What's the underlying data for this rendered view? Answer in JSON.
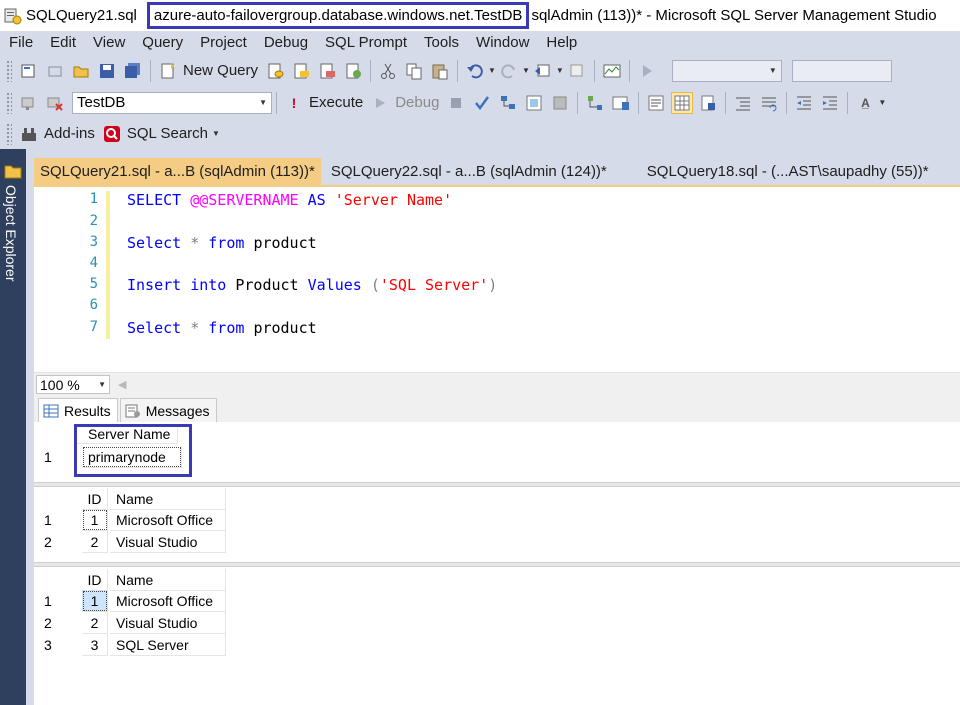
{
  "window": {
    "file_title": "SQLQuery21.sql",
    "server_db": "azure-auto-failovergroup.database.windows.net.TestDB",
    "title_rest": "sqlAdmin (113))* - Microsoft SQL Server Management Studio"
  },
  "menu": [
    "File",
    "Edit",
    "View",
    "Query",
    "Project",
    "Debug",
    "SQL Prompt",
    "Tools",
    "Window",
    "Help"
  ],
  "toolbar": {
    "new_query": "New Query",
    "database": "TestDB",
    "execute": "Execute",
    "debug": "Debug",
    "add_ins": "Add-ins",
    "sql_search": "SQL Search"
  },
  "side_panel": {
    "label": "Object Explorer"
  },
  "tabs": [
    {
      "label": "SQLQuery21.sql - a...B (sqlAdmin (113))*",
      "active": true
    },
    {
      "label": "SQLQuery22.sql - a...B (sqlAdmin (124))*",
      "active": false
    },
    {
      "label": "SQLQuery18.sql - (...AST\\saupadhy (55))*",
      "active": false
    }
  ],
  "editor": {
    "line_numbers": [
      "1",
      "2",
      "3",
      "4",
      "5",
      "6",
      "7"
    ],
    "lines": [
      {
        "kw1": "SELECT",
        "sysvar": "@@SERVERNAME",
        "kw2": "AS",
        "str": "'Server Name'"
      },
      {
        "kw1": "Select",
        "op": "*",
        "kw2": "from",
        "id": "product"
      },
      {
        "kw1": "Insert",
        "kw2": "into",
        "id": "Product",
        "kw3": "Values",
        "lp": "(",
        "str": "'SQL Server'",
        "rp": ")"
      },
      {
        "kw1": "Select",
        "op": "*",
        "kw2": "from",
        "id": "product"
      }
    ]
  },
  "zoom": {
    "value": "100 %"
  },
  "result_tabs": {
    "results": "Results",
    "messages": "Messages"
  },
  "grid1": {
    "header": "Server Name",
    "row_num": "1",
    "value": "primarynode"
  },
  "grid2": {
    "headers": [
      "ID",
      "Name"
    ],
    "rows": [
      {
        "n": "1",
        "id": "1",
        "name": "Microsoft Office"
      },
      {
        "n": "2",
        "id": "2",
        "name": "Visual Studio"
      }
    ]
  },
  "grid3": {
    "headers": [
      "ID",
      "Name"
    ],
    "rows": [
      {
        "n": "1",
        "id": "1",
        "name": "Microsoft Office"
      },
      {
        "n": "2",
        "id": "2",
        "name": "Visual Studio"
      },
      {
        "n": "3",
        "id": "3",
        "name": "SQL Server"
      }
    ]
  },
  "colors": {
    "highlight_box": "#3a3ab8",
    "active_tab": "#f5cc84",
    "keyword": "#0000ff",
    "string": "#ff0000",
    "system_variable": "#ff00ff"
  }
}
